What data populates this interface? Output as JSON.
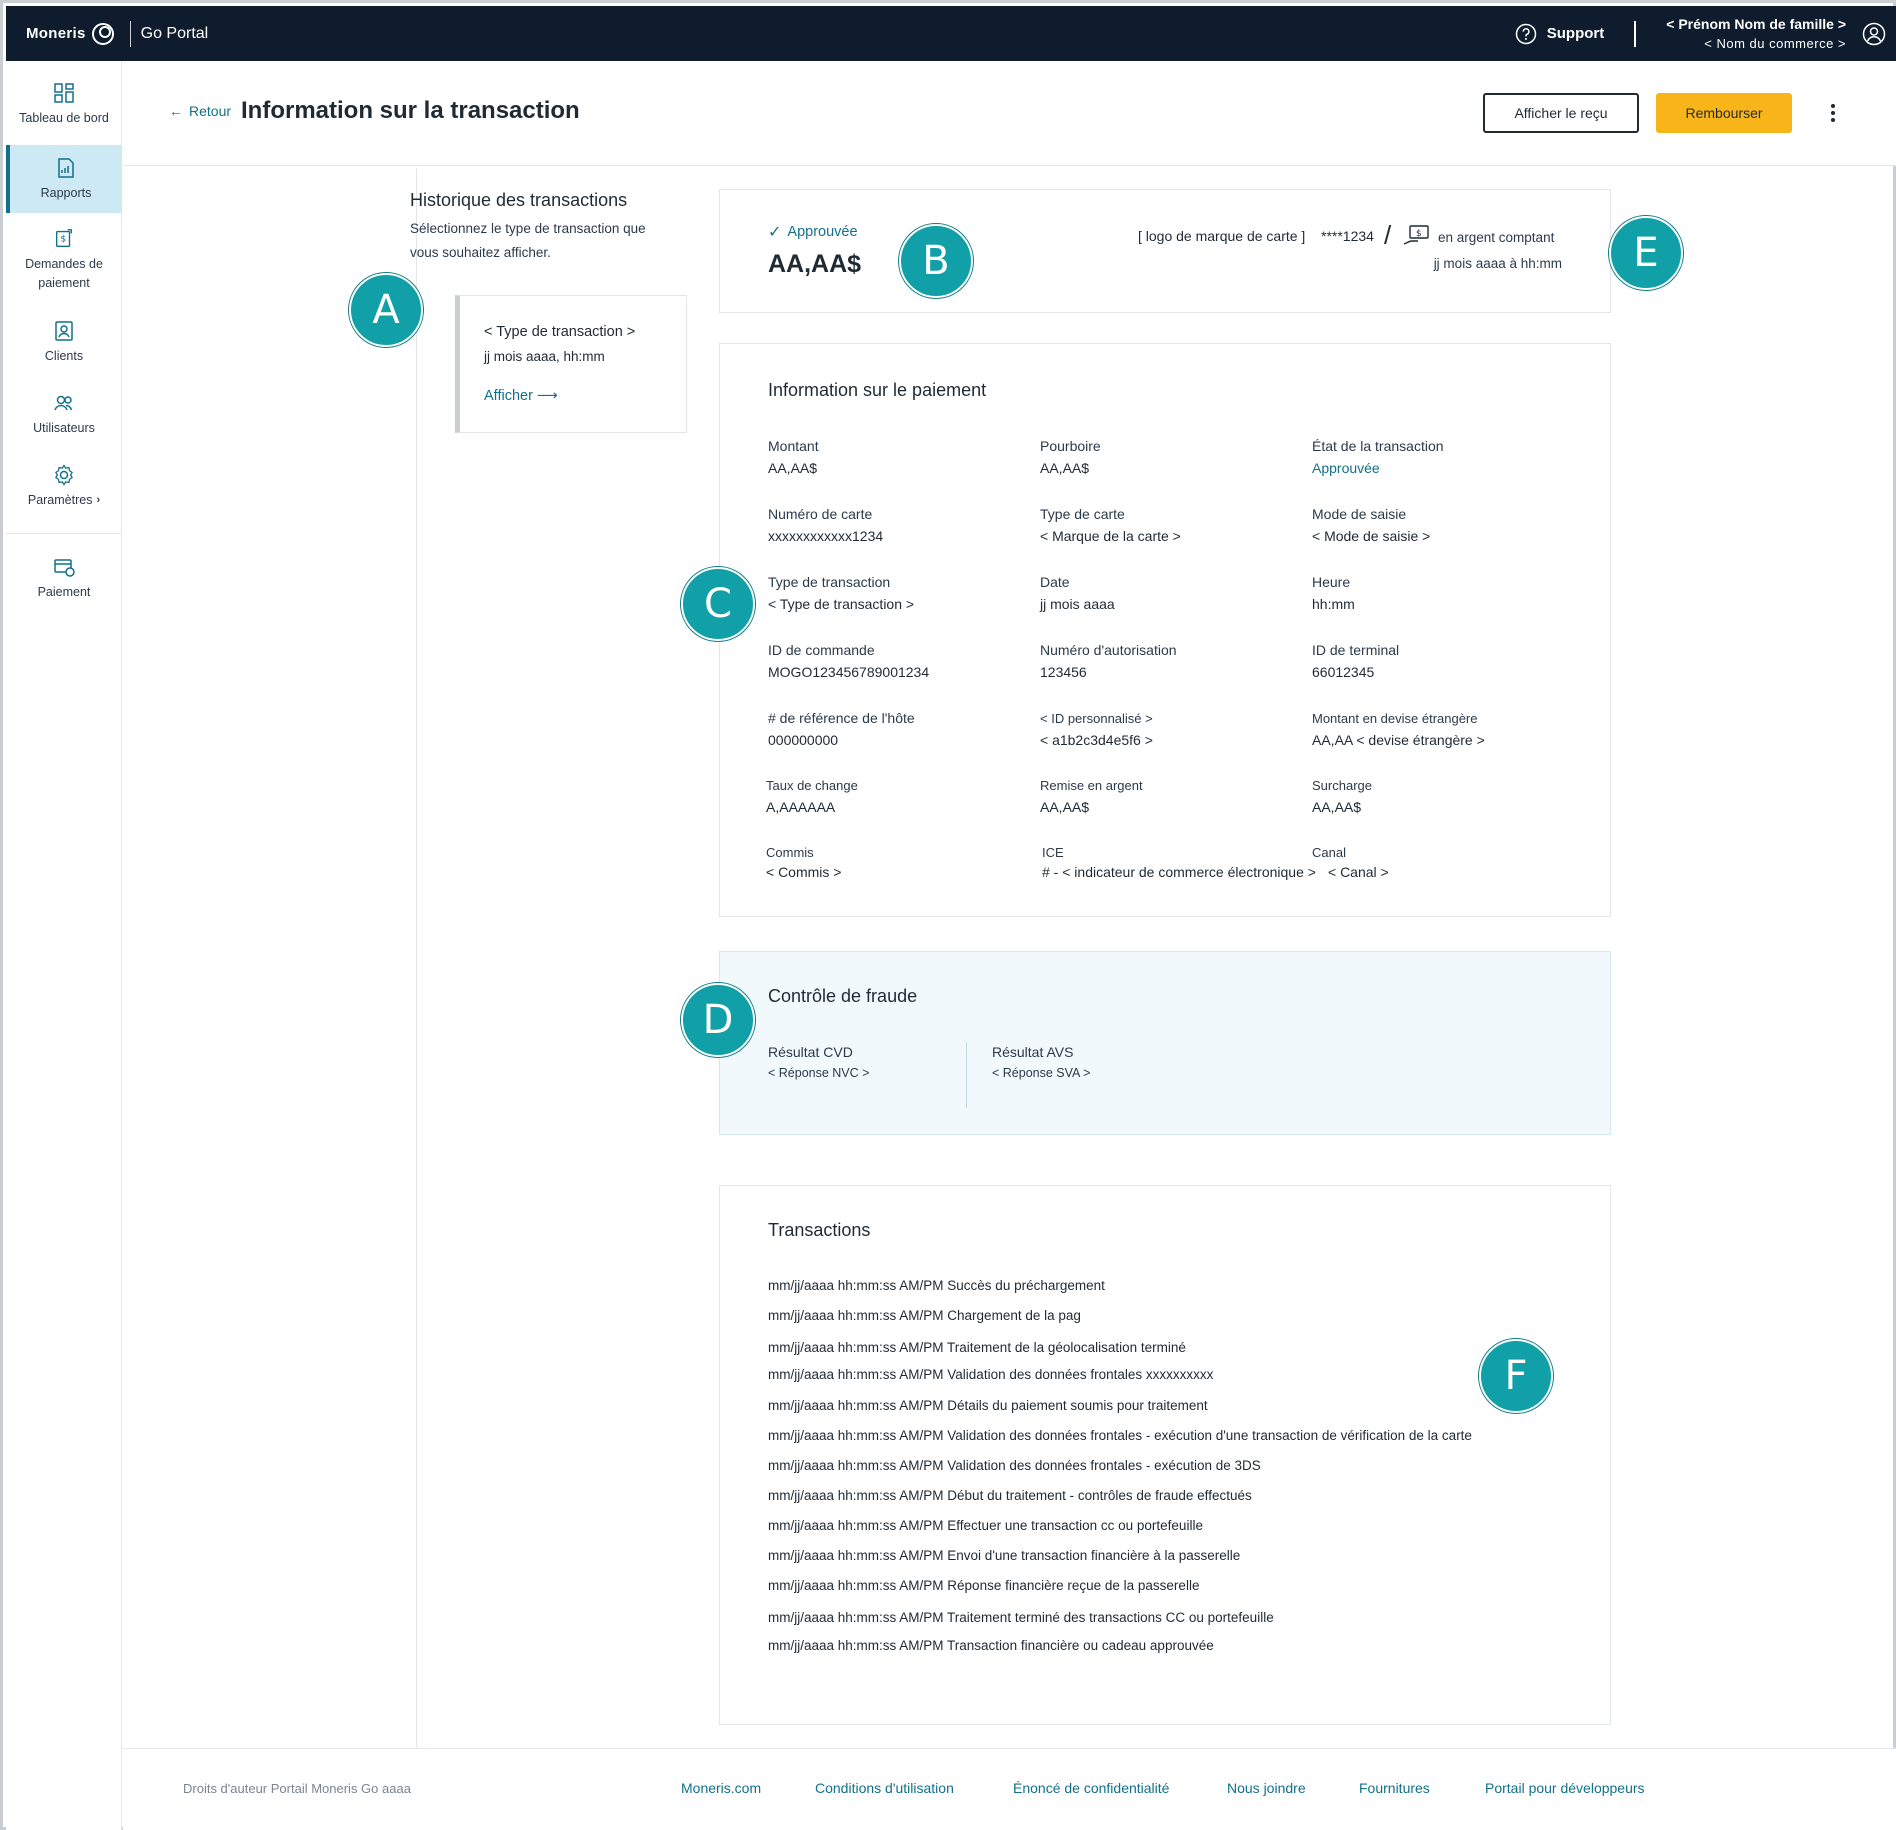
{
  "topbar": {
    "brand": "Moneris",
    "portal": "Go Portal",
    "support": "Support",
    "user_name": "< Prénom Nom de famille >",
    "store_name": "< Nom du commerce >",
    "colors": {
      "bar": "#0e1c2e",
      "accent": "#12708a",
      "primary_button": "#f7b519"
    }
  },
  "sidebar": {
    "items": [
      {
        "label": "Tableau de bord",
        "icon": "dashboard-icon"
      },
      {
        "label": "Rapports",
        "icon": "reports-icon",
        "active": true
      },
      {
        "label": "Demandes de",
        "label2": "paiement",
        "icon": "payment-request-icon"
      },
      {
        "label": "Clients",
        "icon": "clients-icon"
      },
      {
        "label": "Utilisateurs",
        "icon": "users-icon"
      },
      {
        "label": "Paramètres",
        "icon": "settings-icon"
      },
      {
        "label": "Paiement",
        "icon": "payment-icon"
      }
    ]
  },
  "header": {
    "back": "Retour",
    "title": "Information sur la transaction",
    "receipt_button": "Afficher le reçu",
    "refund_button": "Rembourser"
  },
  "history": {
    "title": "Historique des transactions",
    "subtitle_line1": "Sélectionnez le type de transaction que",
    "subtitle_line2": "vous souhaitez afficher.",
    "card": {
      "type": "< Type de transaction >",
      "date": "jj mois aaaa, hh:mm",
      "link": "Afficher"
    }
  },
  "summary": {
    "status": "Approuvée",
    "amount": "AA,AA$",
    "card_brand": "[ logo de marque de carte ]",
    "card_number": "****1234",
    "cash_label": "en argent comptant",
    "datetime": "jj mois aaaa à hh:mm"
  },
  "payment_info": {
    "title": "Information sur le paiement",
    "fields": [
      {
        "label": "Montant",
        "value": "AA,AA$"
      },
      {
        "label": "Pourboire",
        "value": "AA,AA$"
      },
      {
        "label": "État de la transaction",
        "value": "Approuvée"
      },
      {
        "label": "Numéro de carte",
        "value": "xxxxxxxxxxxx1234"
      },
      {
        "label": "Type de carte",
        "value": "< Marque de la carte >"
      },
      {
        "label": "Mode de saisie",
        "value": "< Mode de saisie >"
      },
      {
        "label": "Type de transaction",
        "value": "< Type de transaction >"
      },
      {
        "label": "Date",
        "value": "jj mois aaaa"
      },
      {
        "label": "Heure",
        "value": "hh:mm"
      },
      {
        "label": "ID de commande",
        "value": "MOGO123456789001234"
      },
      {
        "label": "Numéro d'autorisation",
        "value": "123456"
      },
      {
        "label": "ID de terminal",
        "value": "66012345"
      },
      {
        "label": "# de référence de l'hôte",
        "value": "000000000"
      },
      {
        "label": "< ID personnalisé >",
        "value": "< a1b2c3d4e5f6 >"
      },
      {
        "label": "Montant en devise étrangère",
        "value": "AA,AA < devise étrangère >"
      },
      {
        "label": "Taux de change",
        "value": "A,AAAAAA"
      },
      {
        "label": "Remise en argent",
        "value": "AA,AA$"
      },
      {
        "label": "Surcharge",
        "value": "AA,AA$"
      },
      {
        "label": "Commis",
        "value": "< Commis >"
      },
      {
        "label": "ICE",
        "value": "# - < indicateur de commerce électronique >"
      },
      {
        "label": "Canal",
        "value": "< Canal >"
      }
    ]
  },
  "fraud": {
    "title": "Contrôle de fraude",
    "cvd_label": "Résultat CVD",
    "cvd_value": "< Réponse NVC >",
    "avs_label": "Résultat AVS",
    "avs_value": "< Réponse SVA >"
  },
  "transactions": {
    "title": "Transactions",
    "rows": [
      "mm/jj/aaaa hh:mm:ss AM/PM  Succès du préchargement",
      "mm/jj/aaaa hh:mm:ss AM/PM  Chargement de la pag",
      "mm/jj/aaaa hh:mm:ss AM/PM  Traitement de la géolocalisation terminé",
      "mm/jj/aaaa hh:mm:ss AM/PM  Validation des données frontales xxxxxxxxxx",
      "mm/jj/aaaa hh:mm:ss AM/PM  Détails du paiement soumis pour traitement",
      "mm/jj/aaaa hh:mm:ss AM/PM  Validation des données frontales - exécution d'une transaction de vérification de la carte",
      "mm/jj/aaaa hh:mm:ss AM/PM  Validation des données frontales - exécution de 3DS",
      "mm/jj/aaaa hh:mm:ss AM/PM  Début du traitement - contrôles de fraude effectués",
      "mm/jj/aaaa hh:mm:ss AM/PM  Effectuer une transaction cc ou portefeuille",
      "mm/jj/aaaa hh:mm:ss AM/PM  Envoi d'une transaction financière à la passerelle",
      "mm/jj/aaaa hh:mm:ss AM/PM  Réponse financière reçue de la passerelle",
      "mm/jj/aaaa hh:mm:ss AM/PM  Traitement terminé des transactions CC ou portefeuille",
      "mm/jj/aaaa hh:mm:ss AM/PM  Transaction financière ou cadeau approuvée"
    ]
  },
  "callouts": [
    "A",
    "B",
    "C",
    "D",
    "E",
    "F"
  ],
  "footer": {
    "copyright": "Droits d'auteur Portail Moneris Go  aaaa",
    "links": [
      "Moneris.com",
      "Conditions d'utilisation",
      "Énoncé de confidentialité",
      "Nous joindre",
      "Fournitures",
      "Portail pour développeurs"
    ]
  }
}
